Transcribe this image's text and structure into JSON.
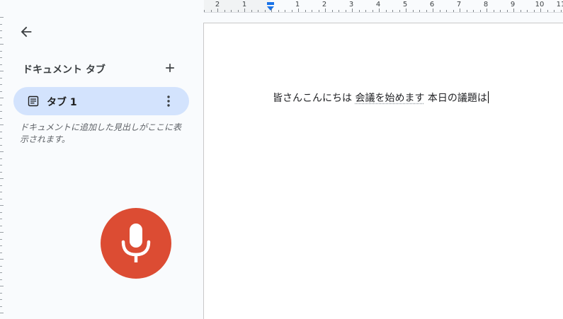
{
  "ruler": {
    "labels": [
      "2",
      "1",
      "1",
      "2",
      "3",
      "4",
      "5",
      "6",
      "7",
      "8",
      "9",
      "10",
      "11"
    ]
  },
  "sidebar": {
    "back_icon": "arrow-back-icon",
    "heading": "ドキュメント タブ",
    "add_icon": "plus-icon",
    "tab": {
      "label": "タブ 1",
      "icon": "document-icon",
      "more_icon": "more-vert-icon"
    },
    "outline_hint": "ドキュメントに追加した見出しがここに表示されます。"
  },
  "voice": {
    "icon": "microphone-icon",
    "color": "#dc4c33"
  },
  "document": {
    "text_part1": "皆さんこんにちは ",
    "text_part2": "会議を始めます",
    "text_part3": " 本日の議題は"
  },
  "colors": {
    "active_tab": "#d3e3fd",
    "sidebar_bg": "#f9fbfd"
  }
}
